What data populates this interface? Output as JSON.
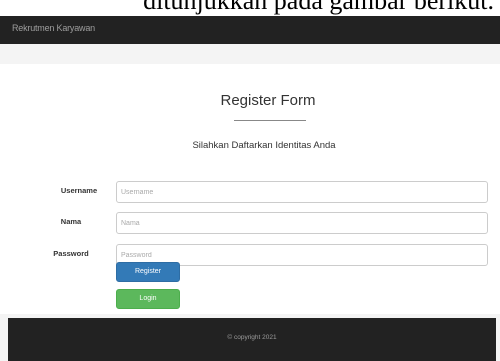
{
  "document": {
    "caption_fragment": "ditunjukkan pada gambar berikut."
  },
  "navbar": {
    "brand": "Rekrutmen Karyawan"
  },
  "form": {
    "title": "Register Form",
    "subtitle": "Silahkan Daftarkan Identitas Anda",
    "fields": [
      {
        "label": "Username",
        "value": "",
        "placeholder": "Username"
      },
      {
        "label": "Nama",
        "value": "",
        "placeholder": "Nama"
      },
      {
        "label": "Password",
        "value": "",
        "placeholder": "Password"
      }
    ],
    "register_label": "Register",
    "login_label": "Login"
  },
  "footer": {
    "copyright": "© copyright 2021"
  },
  "colors": {
    "navbar_bg": "#222222",
    "register_button": "#337ab7",
    "login_button": "#5cb85c"
  }
}
